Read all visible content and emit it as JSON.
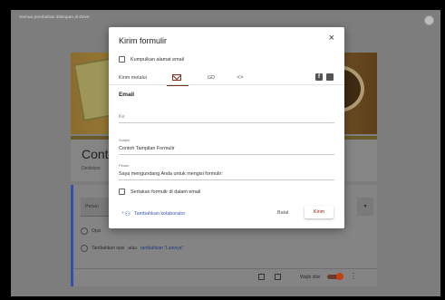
{
  "topbar": {
    "save_note": "Semua perubahan disimpan di Drive"
  },
  "form": {
    "title": "Cont",
    "description": "Deskripsi"
  },
  "question": {
    "label": "Pertan",
    "option_label": "Opsi",
    "add_option_text": "Tambahkan opsi",
    "add_option_or": "atau",
    "add_other_link": "tambahkan \"Lainnya\"",
    "required_label": "Wajib diisi"
  },
  "dialog": {
    "title": "Kirim formulir",
    "close_glyph": "×",
    "collect_email_label": "Kumpulkan alamat email",
    "send_via_label": "Kirim melalui",
    "tab_link_glyph": "GD",
    "tab_embed_glyph": "<>",
    "facebook_glyph": "f",
    "section_title": "Email",
    "to_placeholder": "Ke",
    "subject_label": "Subjek",
    "subject_value": "Contoh Tampilan Formulir",
    "message_label": "Pesan",
    "message_value": "Saya mengundang Anda untuk mengisi formulir:",
    "include_form_label": "Sertakan formulir di dalam email",
    "add_collaborator_label": "Tambahkan kolaborator",
    "cancel_label": "Batal",
    "send_label": "Kirim"
  },
  "colors": {
    "accent": "#8a2a1f",
    "link": "#3a56b0",
    "overlay": "#7d7d7d"
  },
  "icons": [
    "palette-icon",
    "close-icon",
    "email-icon",
    "link-icon",
    "embed-icon",
    "facebook-icon",
    "twitter-icon",
    "add-person-icon",
    "copy-icon",
    "trash-icon",
    "more-vert-icon"
  ]
}
